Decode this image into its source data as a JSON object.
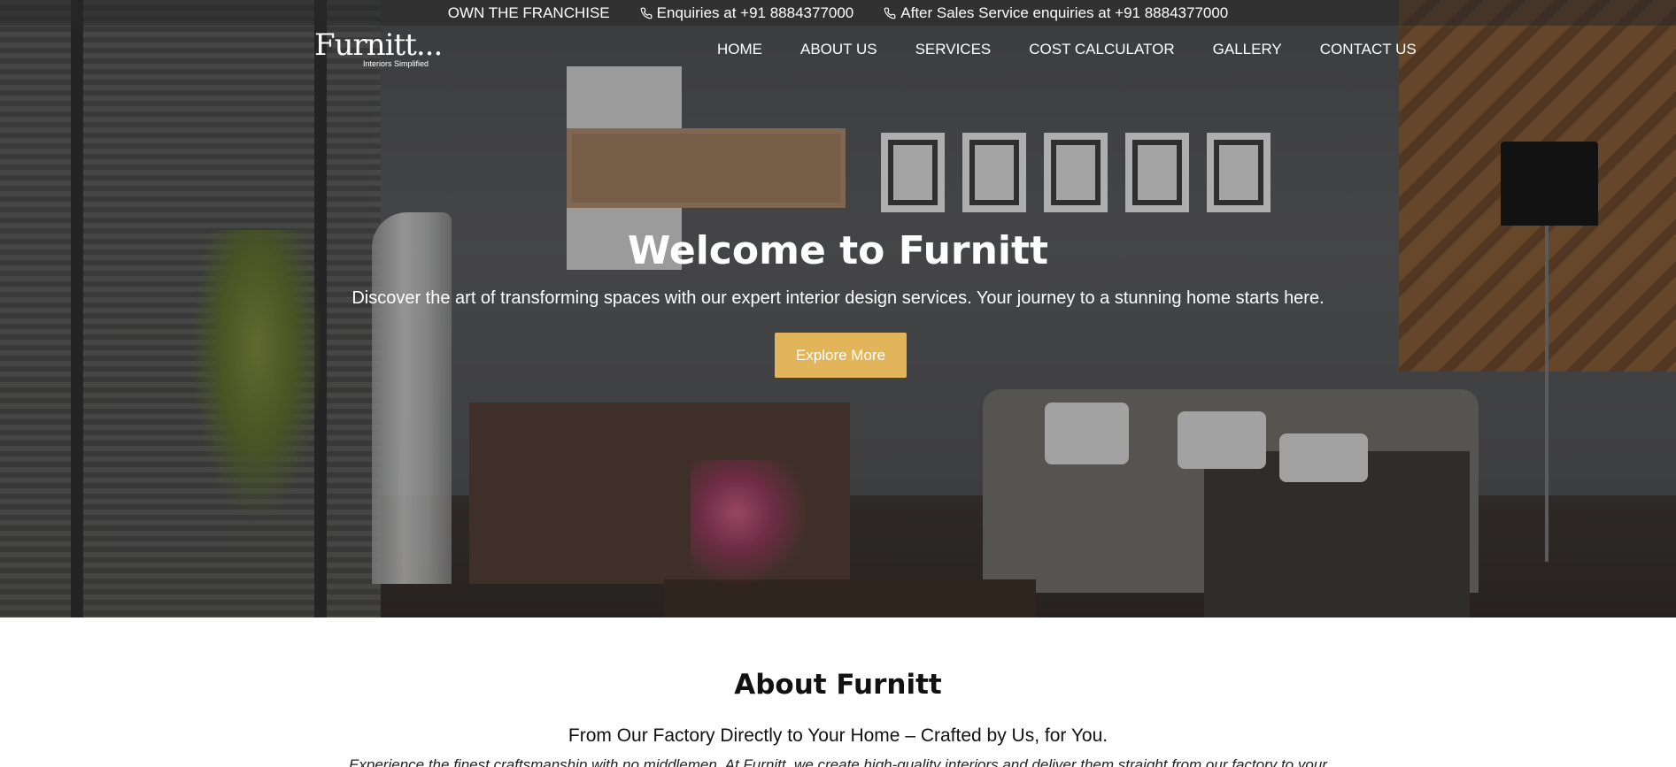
{
  "topbar": {
    "franchise": "OWN THE FRANCHISE",
    "enquiries": "Enquiries at +91 8884377000",
    "after_sales": "After Sales Service enquiries at +91 8884377000"
  },
  "logo": {
    "name": "Furnitt...",
    "tagline": "Interiors Simplified"
  },
  "nav": {
    "items": [
      "HOME",
      "ABOUT US",
      "SERVICES",
      "COST CALCULATOR",
      "GALLERY",
      "CONTACT US"
    ]
  },
  "hero": {
    "title": "Welcome to Furnitt",
    "subtitle": "Discover the art of transforming spaces with our expert interior design services. Your journey to a stunning home starts here.",
    "button_label": "Explore More",
    "button_color": "#e3b55a"
  },
  "about": {
    "title": "About Furnitt",
    "subtitle": "From Our Factory Directly to Your Home – Crafted by Us, for You.",
    "body": "Experience the finest craftsmanship with no middlemen. At Furnitt, we create high-quality interiors and deliver them straight from our factory to your"
  },
  "icons": {
    "phone": "phone-icon"
  }
}
